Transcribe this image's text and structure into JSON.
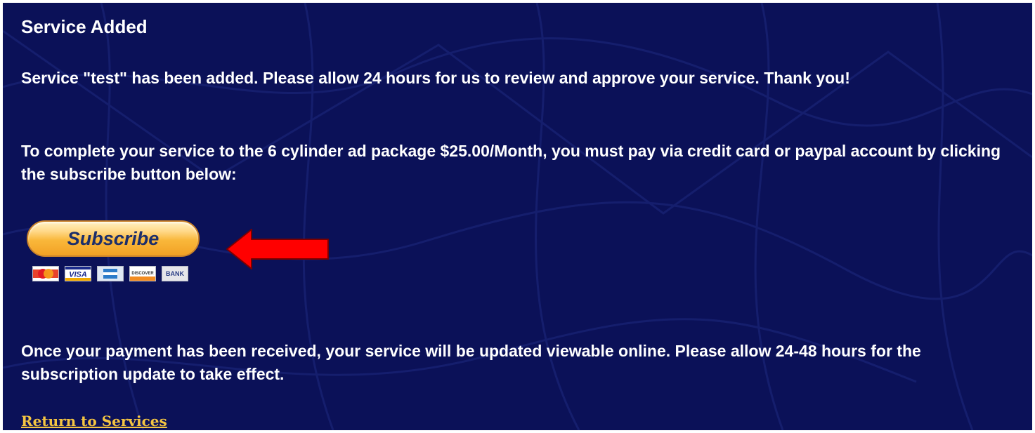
{
  "page": {
    "heading": "Service Added",
    "added_message": "Service \"test\" has been added. Please allow 24 hours for us to review and approve your service. Thank you!",
    "payment_instructions": "To complete your service to the 6 cylinder ad package $25.00/Month, you must pay via credit card or paypal account by clicking the subscribe button below:",
    "payment_note": "Once your payment has been received, your service will be updated viewable online. Please allow 24-48 hours for the subscription update to take effect.",
    "return_link": "Return to Services"
  },
  "paypal": {
    "subscribe_label": "Subscribe",
    "cards": [
      {
        "name": "mastercard-icon",
        "label": "MasterCard"
      },
      {
        "name": "visa-icon",
        "label": "VISA"
      },
      {
        "name": "amex-icon",
        "label": ""
      },
      {
        "name": "discover-icon",
        "label": "DISCOVER"
      },
      {
        "name": "bank-icon",
        "label": "BANK"
      }
    ]
  },
  "colors": {
    "background": "#0b1158",
    "text": "#ffffff",
    "link": "#f4c542",
    "button_gradient_top": "#ffe6a3",
    "button_gradient_bottom": "#f2a125",
    "arrow": "#ff0000"
  }
}
